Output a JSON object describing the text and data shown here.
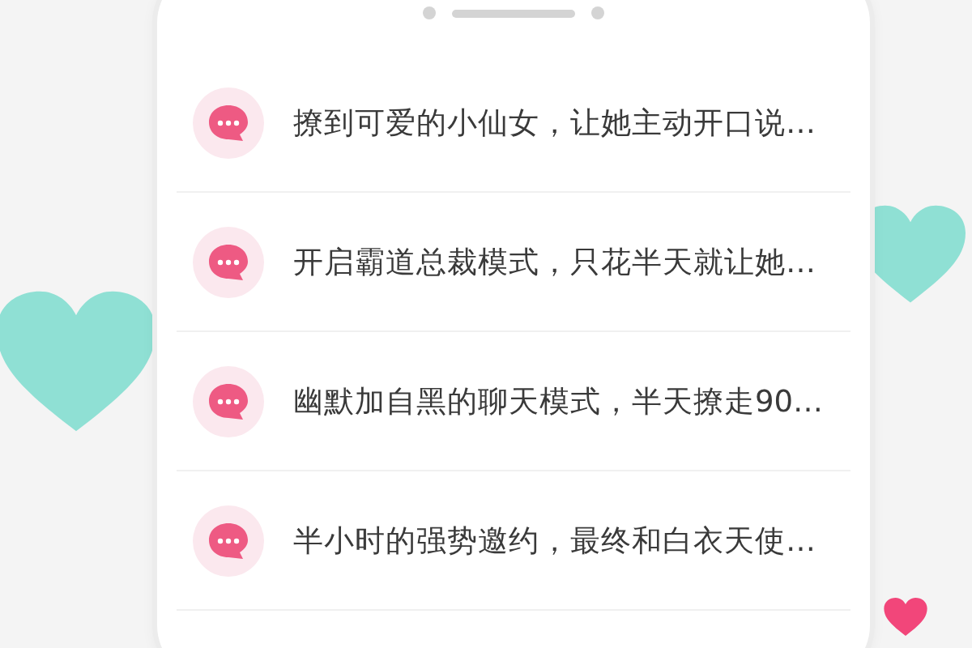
{
  "messages": [
    {
      "text": "撩到可爱的小仙女，让她主动开口说…"
    },
    {
      "text": "开启霸道总裁模式，只花半天就让她…"
    },
    {
      "text": "幽默加自黑的聊天模式，半天撩走90…"
    },
    {
      "text": "半小时的强势邀约，最终和白衣天使…"
    }
  ]
}
